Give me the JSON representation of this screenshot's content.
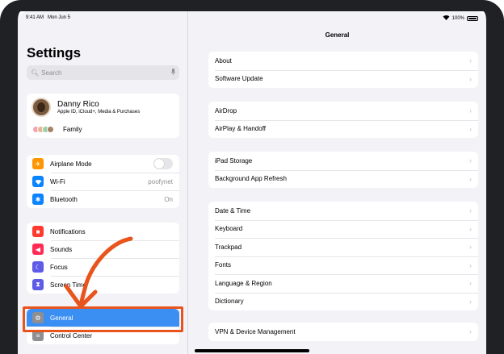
{
  "status_bar": {
    "time": "9:41 AM",
    "date": "Mon Jun 5",
    "battery": "100%"
  },
  "sidebar": {
    "title": "Settings",
    "search_placeholder": "Search",
    "profile": {
      "name": "Danny Rico",
      "subtitle": "Apple ID, iCloud+, Media & Purchases",
      "family_label": "Family"
    },
    "group_connectivity": [
      {
        "label": "Airplane Mode",
        "icon": "airplane-icon",
        "color": "#ff9500",
        "value": ""
      },
      {
        "label": "Wi-Fi",
        "icon": "wifi-icon",
        "color": "#0a84ff",
        "value": "poofynet"
      },
      {
        "label": "Bluetooth",
        "icon": "bluetooth-icon",
        "color": "#0a84ff",
        "value": "On"
      }
    ],
    "group_notifications": [
      {
        "label": "Notifications",
        "icon": "bell-icon",
        "color": "#ff3b30"
      },
      {
        "label": "Sounds",
        "icon": "speaker-icon",
        "color": "#ff2d55"
      },
      {
        "label": "Focus",
        "icon": "moon-icon",
        "color": "#5e5ce6"
      },
      {
        "label": "Screen Time",
        "icon": "hourglass-icon",
        "color": "#5e5ce6"
      }
    ],
    "group_general": [
      {
        "label": "General",
        "icon": "gear-icon",
        "color": "#8e8e93",
        "selected": true
      },
      {
        "label": "Control Center",
        "icon": "switches-icon",
        "color": "#8e8e93",
        "selected": false
      }
    ]
  },
  "detail": {
    "title": "General",
    "groups": [
      [
        "About",
        "Software Update"
      ],
      [
        "AirDrop",
        "AirPlay & Handoff"
      ],
      [
        "iPad Storage",
        "Background App Refresh"
      ],
      [
        "Date & Time",
        "Keyboard",
        "Trackpad",
        "Fonts",
        "Language & Region",
        "Dictionary"
      ],
      [
        "VPN & Device Management"
      ]
    ]
  },
  "annotation": {
    "color": "#e8541b"
  }
}
